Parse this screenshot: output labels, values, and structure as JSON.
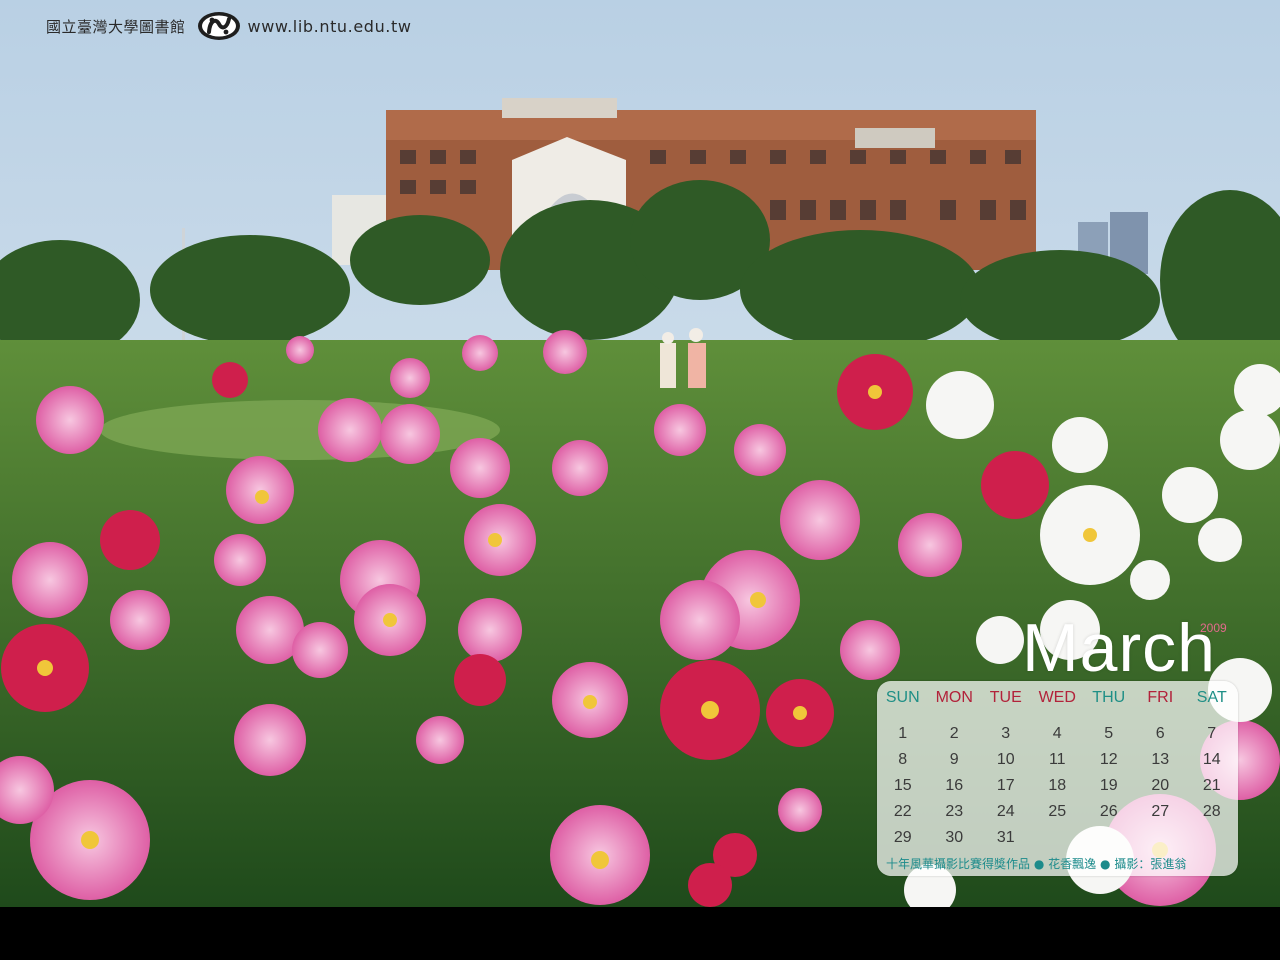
{
  "header": {
    "library_name": "國立臺灣大學圖書館",
    "logo_icon": "ntu-library-logo-icon",
    "url": "www.lib.ntu.edu.tw"
  },
  "calendar": {
    "year": "2009",
    "month": "March",
    "weekdays": [
      {
        "label": "SUN",
        "color": "#1f8f86"
      },
      {
        "label": "MON",
        "color": "#b2223a"
      },
      {
        "label": "TUE",
        "color": "#b2223a"
      },
      {
        "label": "WED",
        "color": "#b2223a"
      },
      {
        "label": "THU",
        "color": "#1f8f86"
      },
      {
        "label": "FRI",
        "color": "#b2223a"
      },
      {
        "label": "SAT",
        "color": "#1f8f86"
      }
    ],
    "days": [
      "1",
      "2",
      "3",
      "4",
      "5",
      "6",
      "7",
      "8",
      "9",
      "10",
      "11",
      "12",
      "13",
      "14",
      "15",
      "16",
      "17",
      "18",
      "19",
      "20",
      "21",
      "22",
      "23",
      "24",
      "25",
      "26",
      "27",
      "28",
      "29",
      "30",
      "31"
    ],
    "caption": {
      "part1": "十年風華攝影比賽得獎作品",
      "part2": "花香飄逸",
      "part3": "攝影：張進翁",
      "separator": "●"
    }
  },
  "colors": {
    "accent_teal": "#1c8b8b",
    "accent_red": "#b2223a",
    "year_pink": "#e26a8c"
  }
}
